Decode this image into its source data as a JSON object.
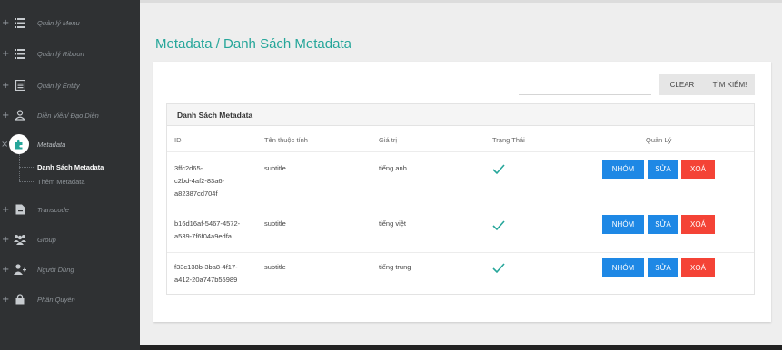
{
  "sidebar": {
    "items": [
      {
        "label": "Quản lý Menu",
        "icon": "list-icon"
      },
      {
        "label": "Quản lý Ribbon",
        "icon": "list-icon"
      },
      {
        "label": "Quản lý Entity",
        "icon": "document-icon"
      },
      {
        "label": "Diễn Viên/ Đạo Diễn",
        "icon": "person-icon"
      },
      {
        "label": "Metadata",
        "icon": "puzzle-icon"
      },
      {
        "label": "Transcode",
        "icon": "file-icon"
      },
      {
        "label": "Group",
        "icon": "group-icon"
      },
      {
        "label": "Người Dùng",
        "icon": "user-add-icon"
      },
      {
        "label": "Phân Quyền",
        "icon": "lock-icon"
      }
    ],
    "plus": "+",
    "minus": "×",
    "sub_items": [
      "Danh Sách Metadata",
      "Thêm Metadata"
    ]
  },
  "page": {
    "title": "Metadata / Danh Sách Metadata"
  },
  "toolbar": {
    "search_placeholder": "",
    "clear_label": "CLEAR",
    "search_label": "TÌM KIẾM!"
  },
  "table": {
    "title": "Danh Sách Metadata",
    "columns": [
      "ID",
      "Tên thuộc tính",
      "Giá trị",
      "Trạng Thái",
      "Quản Lý"
    ],
    "rows": [
      {
        "id_lines": [
          "3ffc2d65-",
          "c2bd-4af2-83a6-",
          "a82387cd704f"
        ],
        "name": "subtitle",
        "value": "tiếng anh",
        "status": "active"
      },
      {
        "id_lines": [
          "b16d16af-5467-4572-",
          "a539-7f6f04a9edfa"
        ],
        "name": "subtitle",
        "value": "tiếng việt",
        "status": "active"
      },
      {
        "id_lines": [
          "f33c138b-3ba8-4f17-",
          "a412-20a747b55989"
        ],
        "name": "subtitle",
        "value": "tiếng trung",
        "status": "active"
      }
    ],
    "actions": {
      "group": "NHÓM",
      "edit": "SỬA",
      "delete": "XOÁ"
    }
  },
  "colors": {
    "accent": "#26a69a",
    "sidebar_bg": "#2f3133",
    "btn_blue": "#1e88e5",
    "btn_red": "#f44336",
    "check": "#26a69a"
  }
}
